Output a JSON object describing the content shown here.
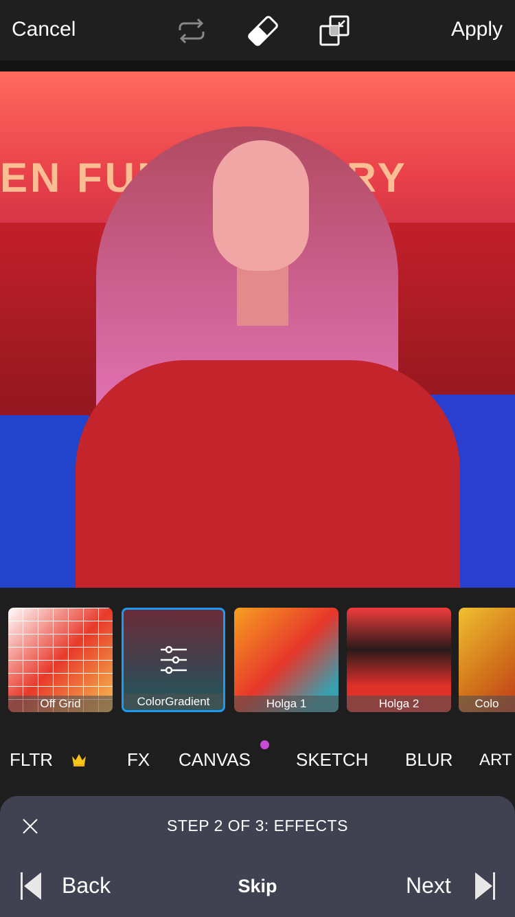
{
  "toolbar": {
    "cancel": "Cancel",
    "apply": "Apply",
    "icons": [
      "repeat-icon",
      "eraser-icon",
      "blend-mode-icon"
    ]
  },
  "effects": [
    {
      "label": "Off Grid",
      "selected": false
    },
    {
      "label": "ColorGradient",
      "selected": true
    },
    {
      "label": "Holga 1",
      "selected": false
    },
    {
      "label": "Holga 2",
      "selected": false
    },
    {
      "label": "Colo",
      "selected": false
    }
  ],
  "categories": [
    {
      "label": "FLTR",
      "premium": true
    },
    {
      "label": "FX"
    },
    {
      "label": "CANVAS",
      "badge": true
    },
    {
      "label": "SKETCH"
    },
    {
      "label": "BLUR"
    },
    {
      "label": "ART"
    }
  ],
  "colors": {
    "accent": "#1d9bf0",
    "badge": "#c84ad8",
    "crown": "#f5c518",
    "panel": "#414251"
  },
  "tutorial": {
    "step": "STEP 2 OF 3: EFFECTS",
    "back": "Back",
    "skip": "Skip",
    "next": "Next"
  }
}
